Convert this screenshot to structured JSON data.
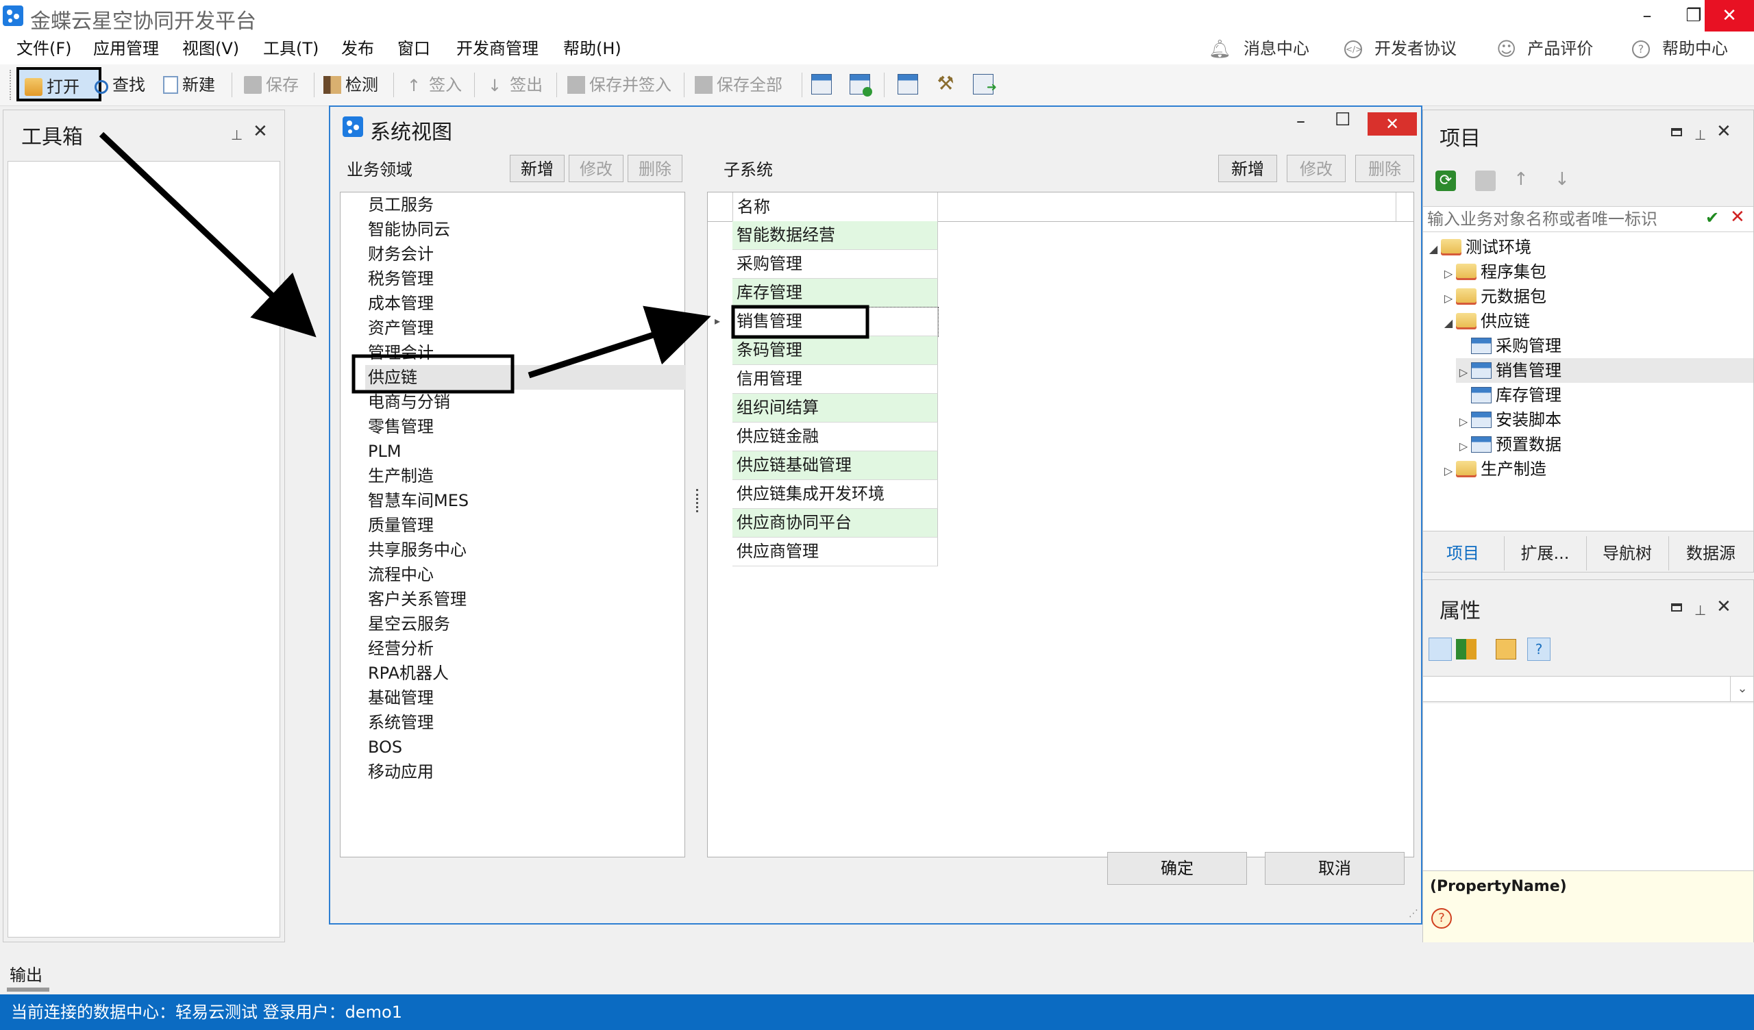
{
  "app": {
    "title": "金蝶云星空协同开发平台",
    "accent": "#0b6bc2"
  },
  "menu": {
    "items": [
      "文件(F)",
      "应用管理",
      "视图(V)",
      "工具(T)",
      "发布",
      "窗口",
      "开发商管理",
      "帮助(H)"
    ],
    "right": [
      "消息中心",
      "开发者协议",
      "产品评价",
      "帮助中心"
    ]
  },
  "toolbar": {
    "open": "打开",
    "find": "查找",
    "new": "新建",
    "save": "保存",
    "check": "检测",
    "checkin": "签入",
    "checkout": "签出",
    "save_checkin": "保存并签入",
    "save_all": "保存全部"
  },
  "toolbox": {
    "title": "工具箱"
  },
  "dialog": {
    "title": "系统视图",
    "domain_label": "业务领域",
    "subsystem_label": "子系统",
    "btn_add": "新增",
    "btn_edit": "修改",
    "btn_delete": "删除",
    "domains": [
      "员工服务",
      "智能协同云",
      "财务会计",
      "税务管理",
      "成本管理",
      "资产管理",
      "管理会计",
      "供应链",
      "电商与分销",
      "零售管理",
      "PLM",
      "生产制造",
      "智慧车间MES",
      "质量管理",
      "共享服务中心",
      "流程中心",
      "客户关系管理",
      "星空云服务",
      "经营分析",
      "RPA机器人",
      "基础管理",
      "系统管理",
      "BOS",
      "移动应用"
    ],
    "selected_domain": "供应链",
    "grid_header": "名称",
    "subsystems": [
      "智能数据经营",
      "采购管理",
      "库存管理",
      "销售管理",
      "条码管理",
      "信用管理",
      "组织间结算",
      "供应链金融",
      "供应链基础管理",
      "供应链集成开发环境",
      "供应商协同平台",
      "供应商管理"
    ],
    "selected_subsystem": "销售管理",
    "ok": "确定",
    "cancel": "取消"
  },
  "project": {
    "title": "项目",
    "search_placeholder": "输入业务对象名称或者唯一标识",
    "tree": [
      {
        "label": "测试环境",
        "level": 0,
        "exp": "◢"
      },
      {
        "label": "程序集包",
        "level": 1,
        "exp": "▷"
      },
      {
        "label": "元数据包",
        "level": 1,
        "exp": "▷"
      },
      {
        "label": "供应链",
        "level": 1,
        "exp": "◢"
      },
      {
        "label": "采购管理",
        "level": 2,
        "exp": ""
      },
      {
        "label": "销售管理",
        "level": 2,
        "exp": "▷"
      },
      {
        "label": "库存管理",
        "level": 2,
        "exp": ""
      },
      {
        "label": "安装脚本",
        "level": 2,
        "exp": "▷"
      },
      {
        "label": "预置数据",
        "level": 2,
        "exp": "▷"
      },
      {
        "label": "生产制造",
        "level": 1,
        "exp": "▷"
      }
    ],
    "tabs": [
      "项目",
      "扩展...",
      "导航树",
      "数据源"
    ]
  },
  "properties": {
    "title": "属性",
    "prop_name": "(PropertyName)"
  },
  "output": {
    "label": "输出"
  },
  "status": {
    "text": "当前连接的数据中心：轻易云测试  登录用户：demo1"
  }
}
